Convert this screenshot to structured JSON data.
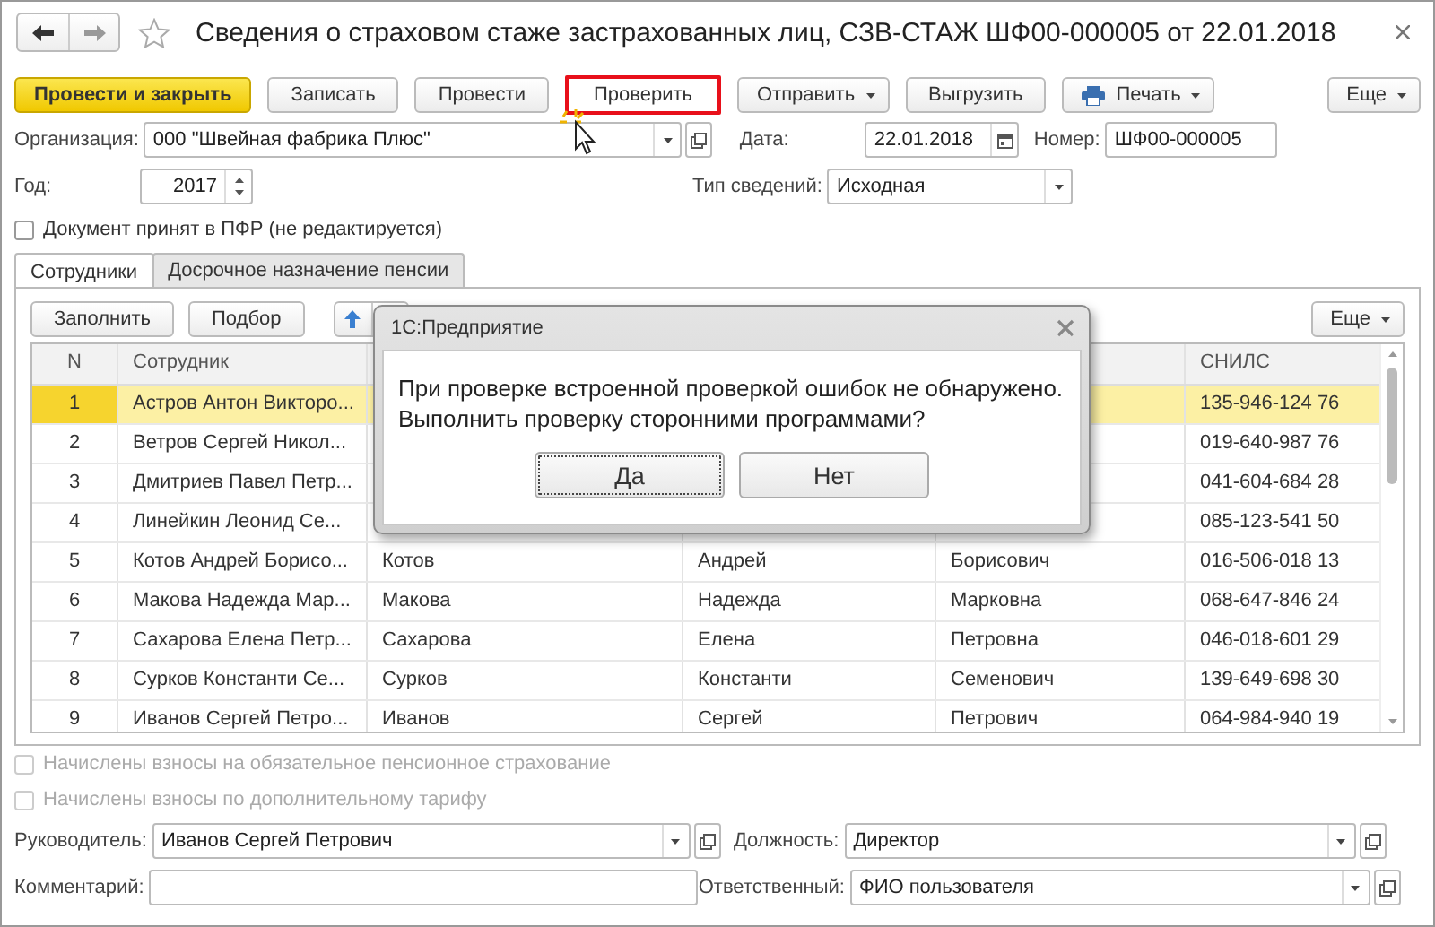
{
  "window": {
    "title": "Сведения о страховом стаже застрахованных лиц, СЗВ-СТАЖ ШФ00-000005 от 22.01.2018",
    "favorite": false
  },
  "toolbar": {
    "buttons": [
      {
        "label": "Провести и закрыть",
        "kind": "primary",
        "highlighted": false
      },
      {
        "label": "Записать",
        "kind": "plain",
        "highlighted": false
      },
      {
        "label": "Провести",
        "kind": "plain",
        "highlighted": false
      },
      {
        "label": "Проверить",
        "kind": "plain",
        "highlighted": true
      },
      {
        "label": "Отправить",
        "kind": "menu",
        "highlighted": false
      },
      {
        "label": "Выгрузить",
        "kind": "plain",
        "highlighted": false
      },
      {
        "label": "Печать",
        "kind": "print",
        "highlighted": false
      }
    ],
    "more": "Еще"
  },
  "organization": {
    "label": "Организация:",
    "value": "000 \"Швейная фабрика Плюс\""
  },
  "date": {
    "label": "Дата:",
    "value": "22.01.2018"
  },
  "number": {
    "label": "Номер:",
    "value": "ШФ00-000005"
  },
  "year": {
    "label": "Год:",
    "value": "2017"
  },
  "info_type": {
    "label": "Тип сведений:",
    "value": "Исходная"
  },
  "pfr_accepted": {
    "label": "Документ принят в ПФР (не редактируется)",
    "checked": false
  },
  "tabs": [
    {
      "label": "Сотрудники",
      "selected": true
    },
    {
      "label": "Досрочное назначение пенсии",
      "selected": false
    }
  ],
  "table_toolbar": {
    "buttons": [
      "Заполнить",
      "Подбор"
    ],
    "more": "Еще"
  },
  "table": {
    "columns": {
      "number": "N",
      "employee": "Сотрудник",
      "snils": "СНИЛС"
    },
    "rows": [
      {
        "number": "1",
        "employee": "Астров Антон Викторо...",
        "snils": "135-946-124 76",
        "selected": true
      },
      {
        "number": "2",
        "employee": "Ветров Сергей Никол...",
        "snils": "019-640-987 76",
        "selected": false
      },
      {
        "number": "3",
        "employee": "Дмитриев Павел Петр...",
        "snils": "041-604-684 28",
        "selected": false
      },
      {
        "number": "4",
        "employee": "Линейкин Леонид Се...",
        "snils": "085-123-541 50",
        "selected": false
      },
      {
        "number": "5",
        "employee": "Котов Андрей Борисо...",
        "column_3": "Котов",
        "column_4": "Андрей",
        "column_5": "Борисович",
        "snils": "016-506-018 13",
        "selected": false
      },
      {
        "number": "6",
        "employee": "Макова Надежда Мар...",
        "column_3": "Макова",
        "column_4": "Надежда",
        "column_5": "Марковна",
        "snils": "068-647-846 24",
        "selected": false
      },
      {
        "number": "7",
        "employee": "Сахарова Елена Петр...",
        "column_3": "Сахарова",
        "column_4": "Елена",
        "column_5": "Петровна",
        "snils": "046-018-601 29",
        "selected": false
      },
      {
        "number": "8",
        "employee": "Сурков Константи Се...",
        "column_3": "Сурков",
        "column_4": "Константи",
        "column_5": "Семенович",
        "snils": "139-649-698 30",
        "selected": false
      },
      {
        "number": "9",
        "employee": "Иванов Сергей Петро...",
        "column_3": "Иванов",
        "column_4": "Сергей",
        "column_5": "Петрович",
        "snils": "064-984-940 19",
        "selected": false
      }
    ]
  },
  "contributions": [
    {
      "label": "Начислены взносы на обязательное пенсионное страхование",
      "checked": false,
      "disabled": true
    },
    {
      "label": "Начислены взносы по дополнительному тарифу",
      "checked": false,
      "disabled": true
    }
  ],
  "manager": {
    "label": "Руководитель:",
    "value": "Иванов Сергей Петрович"
  },
  "position": {
    "label": "Должность:",
    "value": "Директор"
  },
  "comment": {
    "label": "Комментарий:"
  },
  "responsible": {
    "label": "Ответственный:",
    "value": "ФИО пользователя"
  },
  "dialog": {
    "title": "1С:Предприятие",
    "message": [
      "При проверке встроенной проверкой ошибок не обнаружено.",
      "Выполнить проверку сторонними программами?"
    ],
    "buttons": [
      {
        "label": "Да",
        "focused": true
      },
      {
        "label": "Нет",
        "focused": false
      }
    ]
  }
}
